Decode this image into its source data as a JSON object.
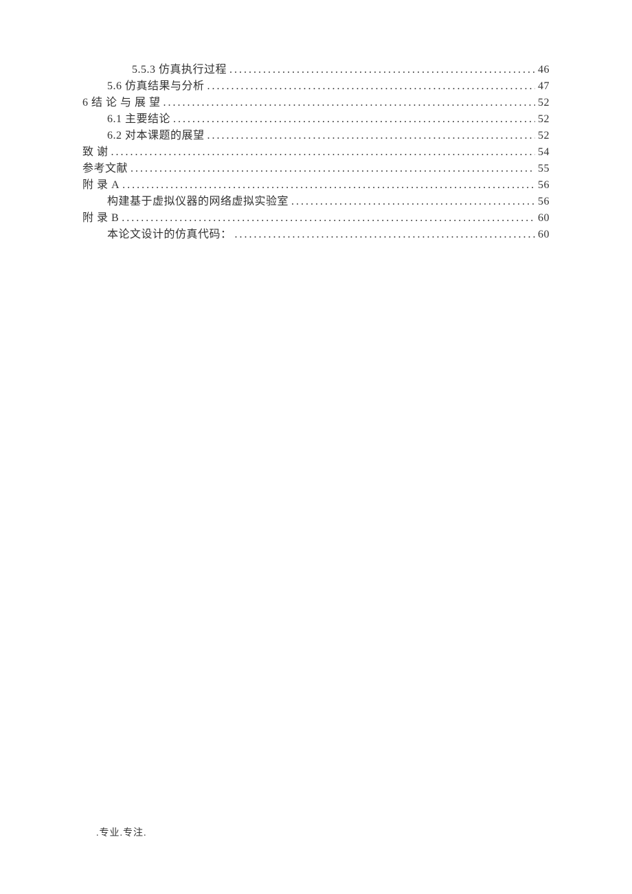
{
  "toc": [
    {
      "indent": 2,
      "label": "5.5.3 仿真执行过程",
      "page": "46"
    },
    {
      "indent": 1,
      "label": "5.6 仿真结果与分析",
      "page": "47"
    },
    {
      "indent": 0,
      "label": "6 结  论 与 展  望",
      "page": "52"
    },
    {
      "indent": 1,
      "label": "6.1 主要结论",
      "page": "52"
    },
    {
      "indent": 1,
      "label": "6.2 对本课题的展望",
      "page": "52"
    },
    {
      "indent": 0,
      "label": "致    谢",
      "page": "54"
    },
    {
      "indent": 0,
      "label": "参考文献",
      "page": "55"
    },
    {
      "indent": 0,
      "label": "附   录 A",
      "page": "56"
    },
    {
      "indent": 1,
      "label": "构建基于虚拟仪器的网络虚拟实验室",
      "page": "56"
    },
    {
      "indent": 0,
      "label": "附   录 B",
      "page": "60"
    },
    {
      "indent": 1,
      "label": "本论文设计的仿真代码：",
      "page": "60"
    }
  ],
  "footer": ".专业.专注."
}
